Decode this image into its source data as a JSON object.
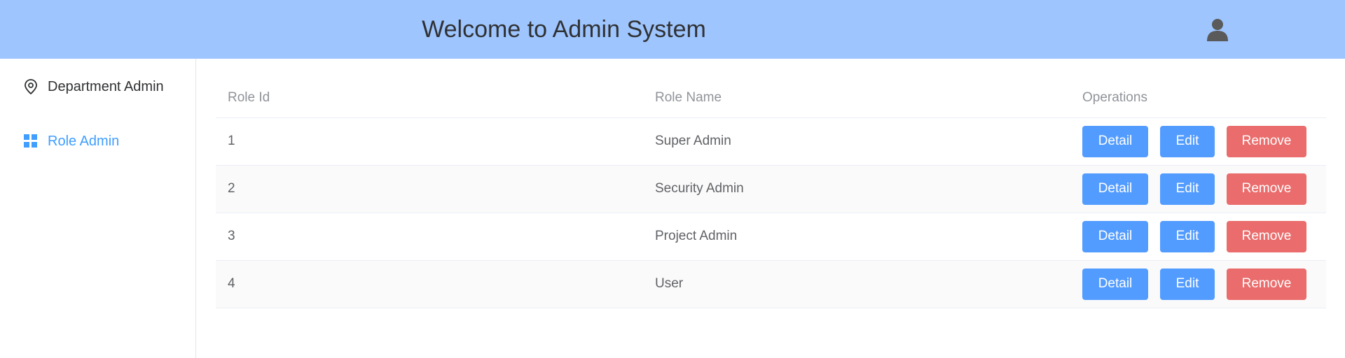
{
  "header": {
    "title": "Welcome to Admin System",
    "avatar_icon": "user-icon"
  },
  "sidebar": {
    "items": [
      {
        "label": "Department Admin",
        "icon": "location-pin-icon",
        "active": false
      },
      {
        "label": "Role Admin",
        "icon": "grid-icon",
        "active": true
      }
    ]
  },
  "table": {
    "columns": [
      "Role Id",
      "Role Name",
      "Operations"
    ],
    "rows": [
      {
        "id": "1",
        "name": "Super Admin"
      },
      {
        "id": "2",
        "name": "Security Admin"
      },
      {
        "id": "3",
        "name": "Project Admin"
      },
      {
        "id": "4",
        "name": "User"
      }
    ],
    "actions": {
      "detail": "Detail",
      "edit": "Edit",
      "remove": "Remove"
    }
  },
  "colors": {
    "header_bg": "#9ec5fe",
    "primary": "#539cff",
    "danger": "#ea6c6c",
    "active_menu": "#409eff"
  }
}
